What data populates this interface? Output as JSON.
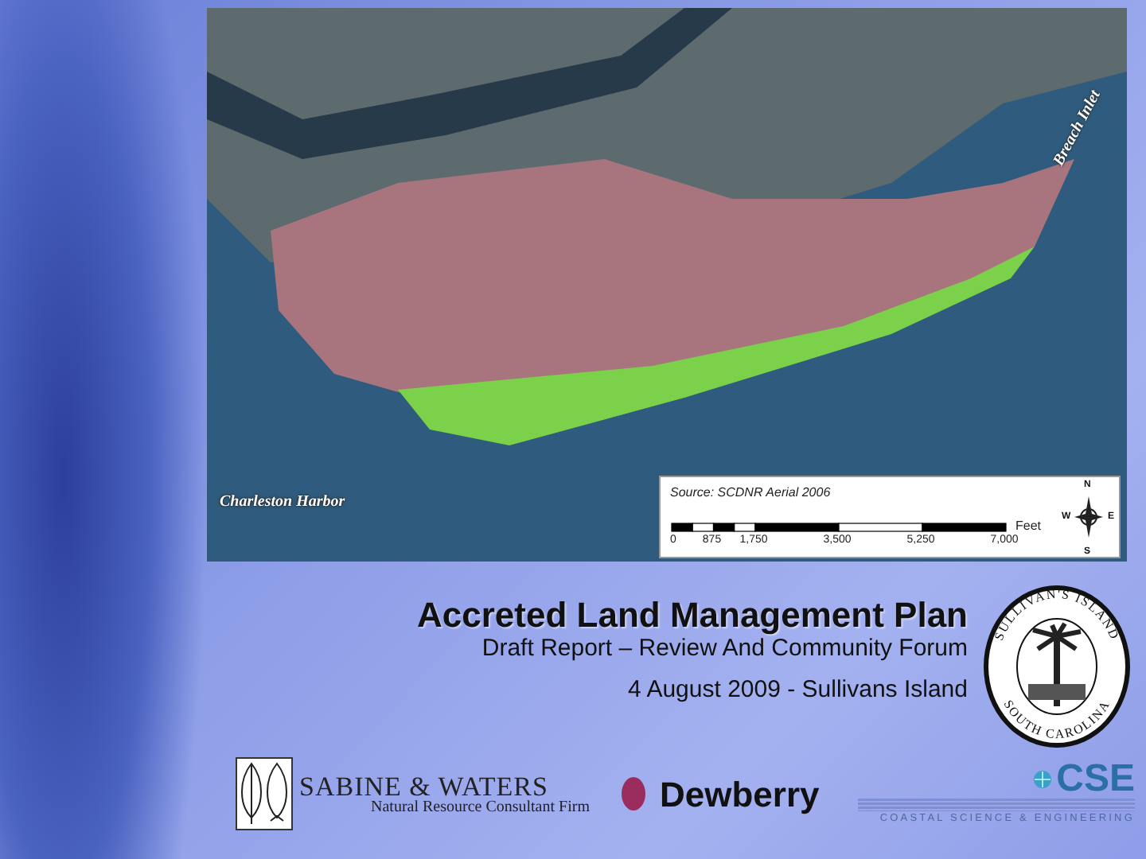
{
  "map": {
    "labels": [
      {
        "text": "Breach Inlet",
        "kind": "rotated"
      },
      {
        "text": "Charleston Harbor",
        "kind": "plain"
      }
    ],
    "legend": {
      "source": "Source: SCDNR Aerial 2006",
      "unit": "Feet",
      "scale_ticks": [
        "0",
        "875",
        "1,750",
        "3,500",
        "5,250",
        "7,000"
      ],
      "compass": [
        "N",
        "W",
        "E",
        "S"
      ]
    }
  },
  "title": "Accreted Land Management Plan",
  "subtitle": "Draft Report – Review And Community Forum",
  "date_line": "4 August 2009 - Sullivans Island",
  "seal": {
    "top_text": "SULLIVAN'S ISLAND",
    "bottom_text": "SOUTH CAROLINA"
  },
  "logos": [
    {
      "kind": "sabine",
      "name": "SABINE & WATERS",
      "tagline": "Natural Resource Consultant Firm"
    },
    {
      "kind": "dewberry",
      "name": "Dewberry"
    },
    {
      "kind": "cse",
      "name": "CSE",
      "tagline": "COASTAL SCIENCE & ENGINEERING"
    }
  ]
}
